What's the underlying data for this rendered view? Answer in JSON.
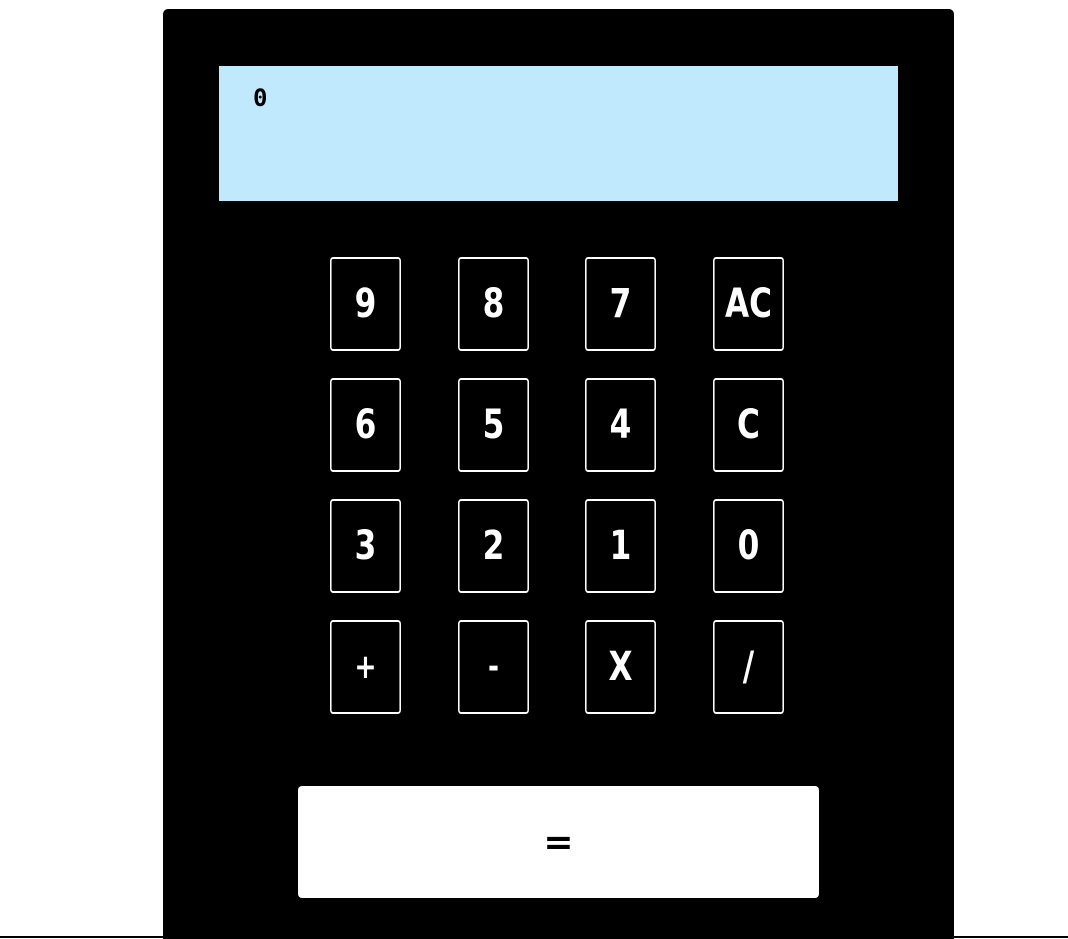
{
  "display": {
    "value": "0",
    "background": "#c1e9fd"
  },
  "keys": {
    "row1": [
      "9",
      "8",
      "7",
      "AC"
    ],
    "row2": [
      "6",
      "5",
      "4",
      "C"
    ],
    "row3": [
      "3",
      "2",
      "1",
      "0"
    ],
    "row4": [
      "+",
      "-",
      "X",
      "/"
    ]
  },
  "equals_label": "=",
  "colors": {
    "body": "#000000",
    "key_border": "#ffffff",
    "equals_bg": "#ffffff"
  }
}
